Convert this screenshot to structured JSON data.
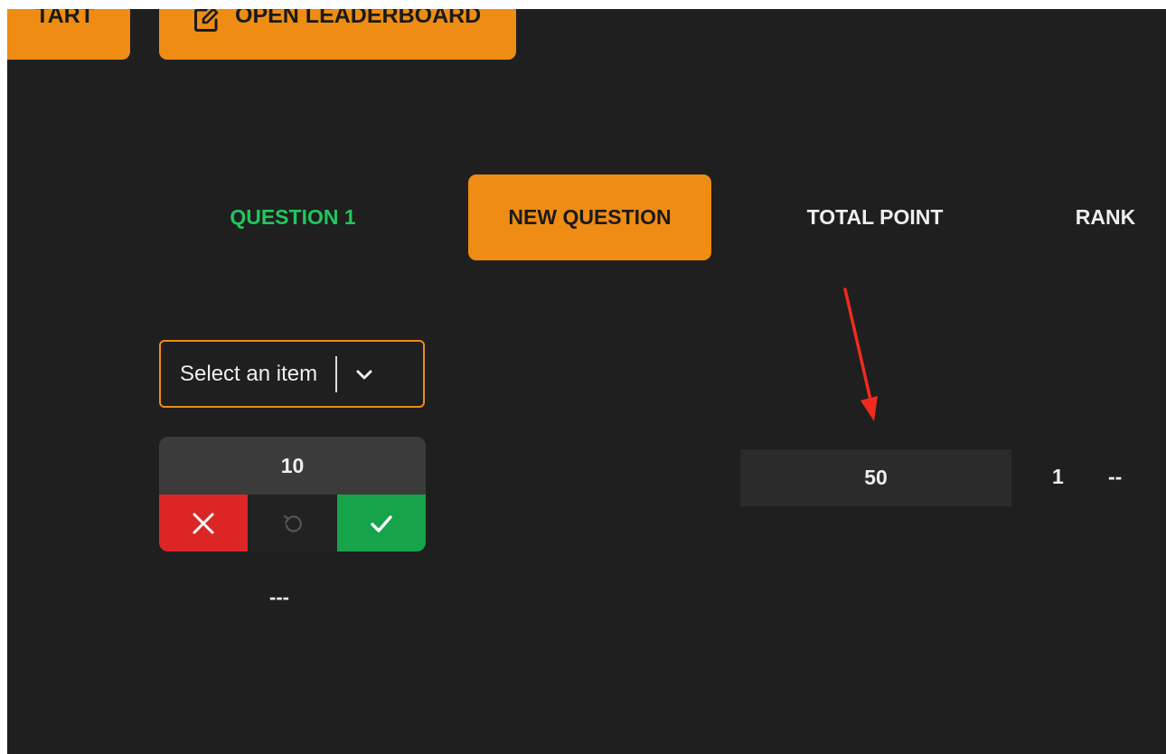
{
  "toolbar": {
    "start_label": "TART",
    "leaderboard_label": "OPEN LEADERBOARD"
  },
  "columns": {
    "question": "QUESTION 1",
    "new_question": "NEW QUESTION",
    "total_point": "TOTAL POINT",
    "rank": "RANK"
  },
  "question_cell": {
    "select_placeholder": "Select an item",
    "points": "10",
    "status": "---"
  },
  "total_point_value": "50",
  "rank_value": "1",
  "rank_change": "--",
  "colors": {
    "background": "#1f1f1f",
    "accent": "#ee8c13",
    "question_header": "#22c55e",
    "reject": "#dc2626",
    "accept": "#16a34a",
    "annotation_arrow": "#ef2b1f"
  },
  "icons": {
    "leaderboard": "edit-icon",
    "select": "chevron-down-icon",
    "reject": "close-icon",
    "reset": "undo-icon",
    "accept": "check-icon"
  }
}
